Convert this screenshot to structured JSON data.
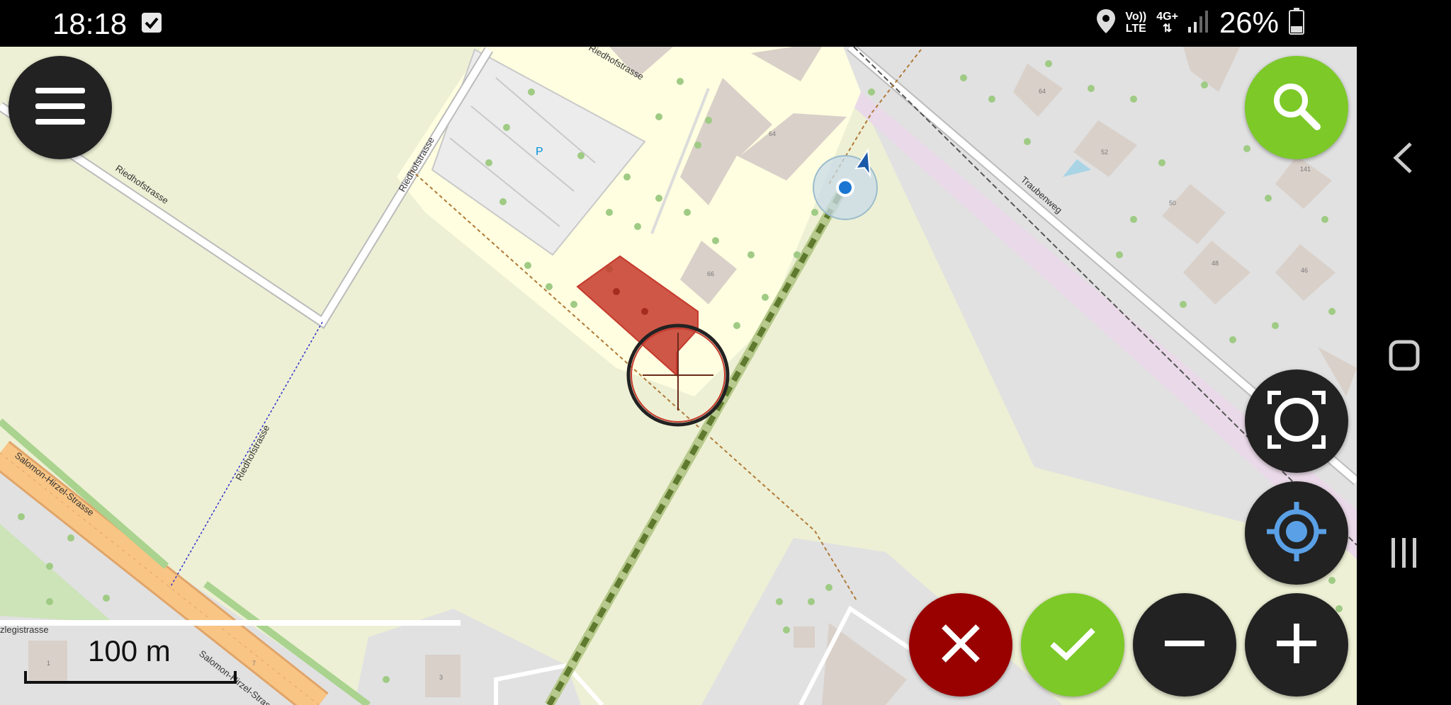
{
  "status_bar": {
    "time": "18:18",
    "network_top": "Vo))",
    "network_bottom": "LTE",
    "data_type": "4G+",
    "battery": "26%",
    "icons": [
      "checkbox-notification-icon",
      "location-pin-icon",
      "signal-bars-icon",
      "battery-icon"
    ]
  },
  "map": {
    "street_labels": {
      "riedhof_top": "Riedhofstrasse",
      "riedhof_left": "Riedhofstrasse",
      "riedhof_mid": "Riedhofstrasse",
      "riedhof_footpath": "Riedhofstrasse",
      "traubenweg": "Traubenweg",
      "salomon_upper": "Salomon-Hirzel-Strasse",
      "salomon_lower": "Salomon-Hirzel-Strasse",
      "ziegelei": "zlegistrasse"
    },
    "parking_label": "P",
    "house_numbers": {
      "b64_main": "64",
      "b66": "66",
      "h64": "64",
      "h52": "52",
      "h141": "141",
      "h50": "50",
      "h48": "48",
      "h46": "46",
      "h1": "1",
      "h7": "7",
      "h3": "3"
    },
    "scale": {
      "label": "100 m"
    },
    "colors": {
      "land": "#edf0d4",
      "school_area": "#fffee0",
      "residential": "#e1e1e1",
      "building": "#d9d0c9",
      "road_major": "#f9c584",
      "selected_area": "#c6392c",
      "path_highlight": "#5f7a2e",
      "railway_area": "#ead9e8"
    }
  },
  "buttons": {
    "menu": {
      "icon": "hamburger-menu-icon"
    },
    "search": {
      "icon": "search-icon"
    },
    "focus": {
      "icon": "focus-frame-icon"
    },
    "my_location": {
      "icon": "gps-crosshair-icon"
    },
    "cancel": {
      "icon": "close-icon"
    },
    "confirm": {
      "icon": "check-icon"
    },
    "zoom_out": {
      "icon": "minus-icon"
    },
    "zoom_in": {
      "icon": "plus-icon"
    }
  },
  "nav_bar": {
    "icons": [
      "back-chevron-icon",
      "home-square-icon",
      "recents-icon"
    ]
  }
}
